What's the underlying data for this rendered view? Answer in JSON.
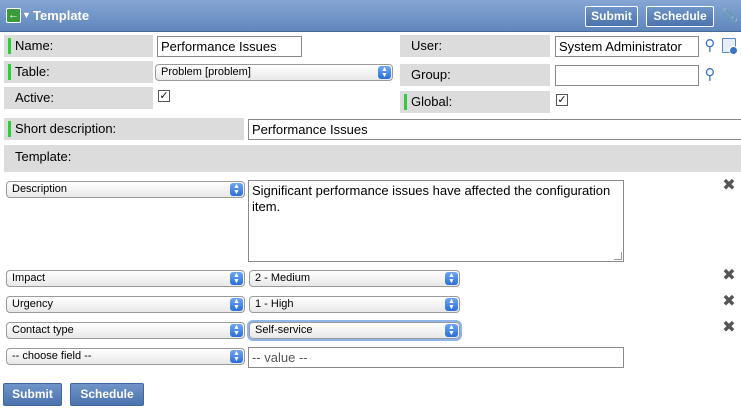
{
  "header": {
    "title": "Template",
    "back_icon": "back-arrow-icon",
    "menu_icon": "chevron-down-icon",
    "submit_label": "Submit",
    "schedule_label": "Schedule",
    "attach_icon": "paperclip-icon"
  },
  "form": {
    "name_label": "Name:",
    "name_value": "Performance Issues",
    "user_label": "User:",
    "user_value": "System Administrator",
    "table_label": "Table:",
    "table_value": "Problem [problem]",
    "group_label": "Group:",
    "group_value": "",
    "active_label": "Active:",
    "active_checked": true,
    "global_label": "Global:",
    "global_checked": true,
    "short_desc_label": "Short description:",
    "short_desc_value": "Performance Issues",
    "template_label": "Template:"
  },
  "template_rows": [
    {
      "field": "Description",
      "value": "Significant performance issues have affected the configuration item."
    },
    {
      "field": "Impact",
      "value": "2 - Medium"
    },
    {
      "field": "Urgency",
      "value": "1 - High"
    },
    {
      "field": "Contact type",
      "value": "Self-service"
    }
  ],
  "new_row": {
    "field_placeholder": "-- choose field --",
    "value_placeholder": "-- value --"
  },
  "footer": {
    "submit_label": "Submit",
    "schedule_label": "Schedule"
  },
  "colors": {
    "header_bg": "#6a8fc2",
    "label_bg": "#dcdcdc",
    "mandatory_indicator": "#34c93d",
    "button_bg": "#5a80b8"
  }
}
